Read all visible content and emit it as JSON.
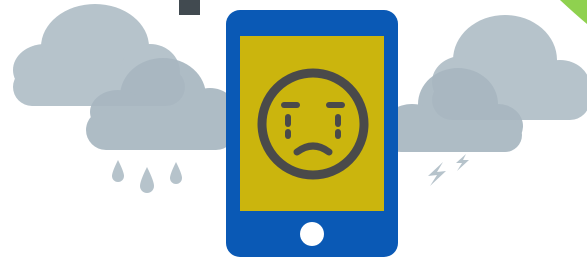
{
  "illustration": {
    "subject": "sad-phone-stormy-weather",
    "colors": {
      "phone_body": "#0a59b5",
      "phone_screen": "#cbb50d",
      "face_stroke": "#4a4a4a",
      "home_button": "#ffffff",
      "cloud": "#b6c3cb",
      "cloud_overlap": "#a4b3bd",
      "rain_drop": "#b6c3cb",
      "lightning": "#b6c3cb",
      "dark_block": "#414a50",
      "green_accent": "#8fd14f"
    }
  }
}
